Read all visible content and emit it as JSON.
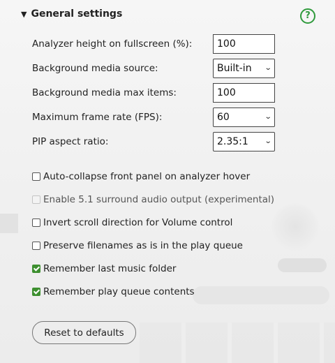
{
  "section": {
    "title": "General settings"
  },
  "help": {
    "glyph": "?"
  },
  "fields": {
    "analyzer_height": {
      "label": "Analyzer height on fullscreen (%):",
      "value": "100"
    },
    "bg_source": {
      "label": "Background media source:",
      "value": "Built-in"
    },
    "bg_max_items": {
      "label": "Background media max items:",
      "value": "100"
    },
    "max_fps": {
      "label": "Maximum frame rate (FPS):",
      "value": "60"
    },
    "pip_ratio": {
      "label": "PIP aspect ratio:",
      "value": "2.35:1"
    }
  },
  "checkboxes": [
    {
      "label": "Auto-collapse front panel on analyzer hover",
      "checked": false,
      "disabled": false
    },
    {
      "label": "Enable 5.1 surround audio output (experimental)",
      "checked": false,
      "disabled": true
    },
    {
      "label": "Invert scroll direction for Volume control",
      "checked": false,
      "disabled": false
    },
    {
      "label": "Preserve filenames as is in the play queue",
      "checked": false,
      "disabled": false
    },
    {
      "label": "Remember last music folder",
      "checked": true,
      "disabled": false
    },
    {
      "label": "Remember play queue contents",
      "checked": true,
      "disabled": false
    }
  ],
  "reset_button": {
    "label": "Reset to defaults"
  },
  "colors": {
    "accent": "#3d8f2f",
    "help": "#2f9a3c"
  }
}
